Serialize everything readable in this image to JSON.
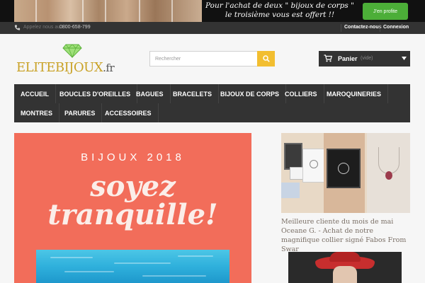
{
  "promo": {
    "line1": "Pour l'achat de deux \" bijoux de corps \"",
    "line2": "le troisième vous est offert !!",
    "button_label": "J'en profite"
  },
  "topbar": {
    "call_label": "Appelez nous au :",
    "phone": "0800-658-799",
    "contact": "Contactez-nous",
    "login": "Connexion"
  },
  "header": {
    "logo_main": "ELITEBIJOUX",
    "logo_tld": ".fr",
    "search_placeholder": "Rechercher",
    "cart_label": "Panier",
    "cart_status": "(vide)"
  },
  "menu": {
    "items": [
      "ACCUEIL",
      "BOUCLES D'OREILLES",
      "BAGUES",
      "BRACELETS",
      "BIJOUX DE CORPS",
      "COLLIERS",
      "MAROQUINERIES",
      "MONTRES",
      "PARURES",
      "ACCESSOIRES"
    ]
  },
  "hero": {
    "kicker": "BIJOUX 2018",
    "line1": "soyez",
    "line2": "tranquille!"
  },
  "sidebar": {
    "caption": "Meilleure cliente du mois de mai Oceane G. - Achat de notre magnifique collier signé Fabos From Swar"
  },
  "colors": {
    "accent": "#f2be30",
    "dark": "#333333",
    "hero_bg": "#f26d5a",
    "logo_gold": "#c9a227",
    "promo_button": "#4cae38"
  },
  "icons": [
    "phone-icon",
    "diamond-icon",
    "search-icon",
    "cart-icon",
    "chevron-down-icon"
  ]
}
